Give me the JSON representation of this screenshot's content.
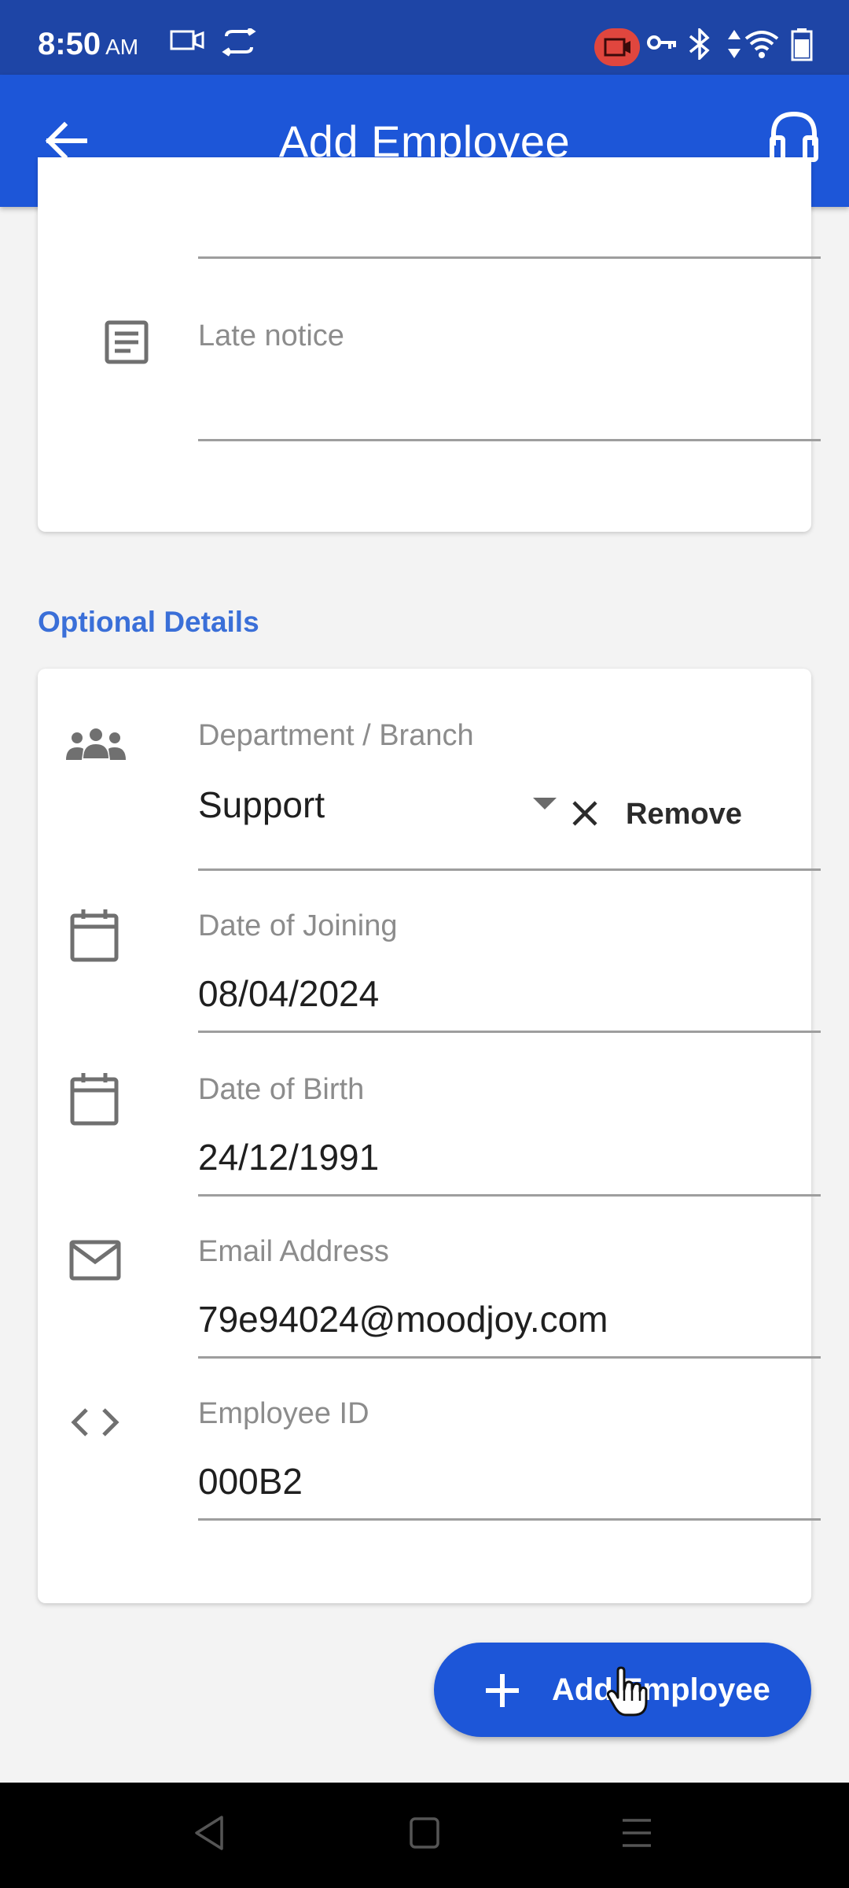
{
  "status_bar": {
    "time": "8:50",
    "ampm": "AM"
  },
  "app_bar": {
    "title": "Add Employee"
  },
  "top_card": {
    "late_notice_label": "Late notice",
    "late_notice_value": ""
  },
  "optional_details": {
    "section_title": "Optional Details",
    "department": {
      "label": "Department / Branch",
      "value": "Support",
      "remove_label": "Remove"
    },
    "date_of_joining": {
      "label": "Date of Joining",
      "value": "08/04/2024"
    },
    "date_of_birth": {
      "label": "Date of Birth",
      "value": "24/12/1991"
    },
    "email": {
      "label": "Email Address",
      "value": "79e94024@moodjoy.com"
    },
    "employee_id": {
      "label": "Employee ID",
      "value": "000B2"
    }
  },
  "fab": {
    "label": "Add Employee"
  },
  "colors": {
    "status_bar": "#1e45a6",
    "app_bar": "#1d56d8",
    "section_title": "#3a6fd8"
  }
}
